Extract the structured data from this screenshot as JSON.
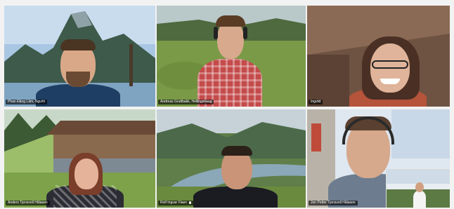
{
  "participants": [
    {
      "name": "Phan Đặng Lâm, Người",
      "muted": false
    },
    {
      "name": "Andreas Gruttbakk, Hellingshaug",
      "muted": false
    },
    {
      "name": "Ingvild",
      "muted": false
    },
    {
      "name": "Anders Tjensvoll Hålasen",
      "muted": false
    },
    {
      "name": "Rolf Ingvar Flaen",
      "muted": true
    },
    {
      "name": "Jon Petter Tjensvoll Hålasen",
      "muted": false
    }
  ],
  "colors": {
    "name_tag_bg": "#000000",
    "name_tag_text": "#ffffff"
  }
}
